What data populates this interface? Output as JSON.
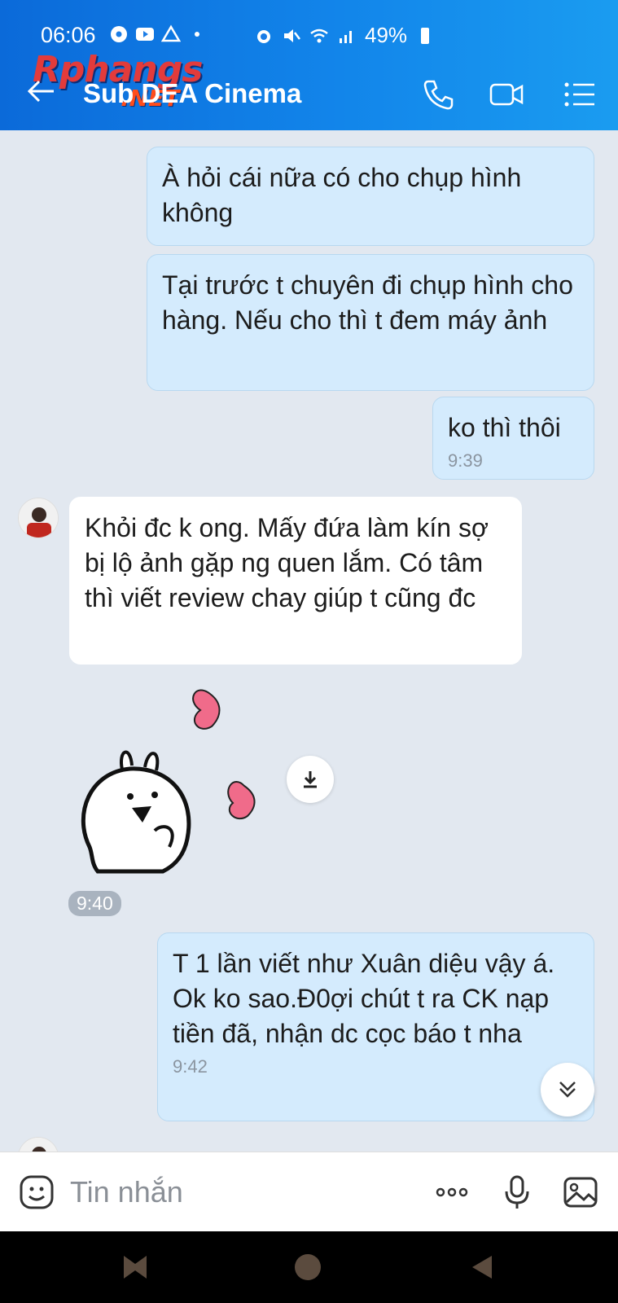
{
  "status_bar": {
    "time": "06:06",
    "battery": "49%",
    "icons": [
      "soccer-icon",
      "youtube-icon",
      "drive-icon",
      "dot-icon",
      "alarm-icon",
      "mute-icon",
      "wifi-icon",
      "signal-icon",
      "battery-icon"
    ]
  },
  "watermark": {
    "brand": "Rphangs",
    "suffix": ".NET"
  },
  "header": {
    "title": "Sub DEA Cinema"
  },
  "messages": [
    {
      "side": "me",
      "text": "À hỏi cái nữa có cho chụp hình không",
      "time": ""
    },
    {
      "side": "me",
      "text": "Tại trước t chuyên đi chụp hình cho hàng. Nếu cho thì t đem máy ảnh",
      "time": ""
    },
    {
      "side": "me",
      "text": "ko thì thôi",
      "time": "9:39"
    },
    {
      "side": "them",
      "text": "Khỏi đc k ong. Mấy đứa làm kín sợ bị lộ ảnh gặp ng quen lắm. Có tâm thì viết review chay giúp t cũng đc",
      "time": ""
    },
    {
      "side": "them",
      "type": "sticker",
      "time": "9:40"
    },
    {
      "side": "me",
      "text": "T 1 lần viết như Xuân diệu vậy á. Ok ko sao.Đ0ợi chút t ra CK nạp tiền đã, nhận dc cọc báo t nha",
      "time": "9:42"
    }
  ],
  "input": {
    "placeholder": "Tin nhắn"
  },
  "colors": {
    "header": "#1285ea",
    "my_bubble": "#d4ebfd",
    "their_bubble": "#ffffff",
    "chat_bg": "#e2e8f0",
    "heart": "#f06b8a"
  }
}
